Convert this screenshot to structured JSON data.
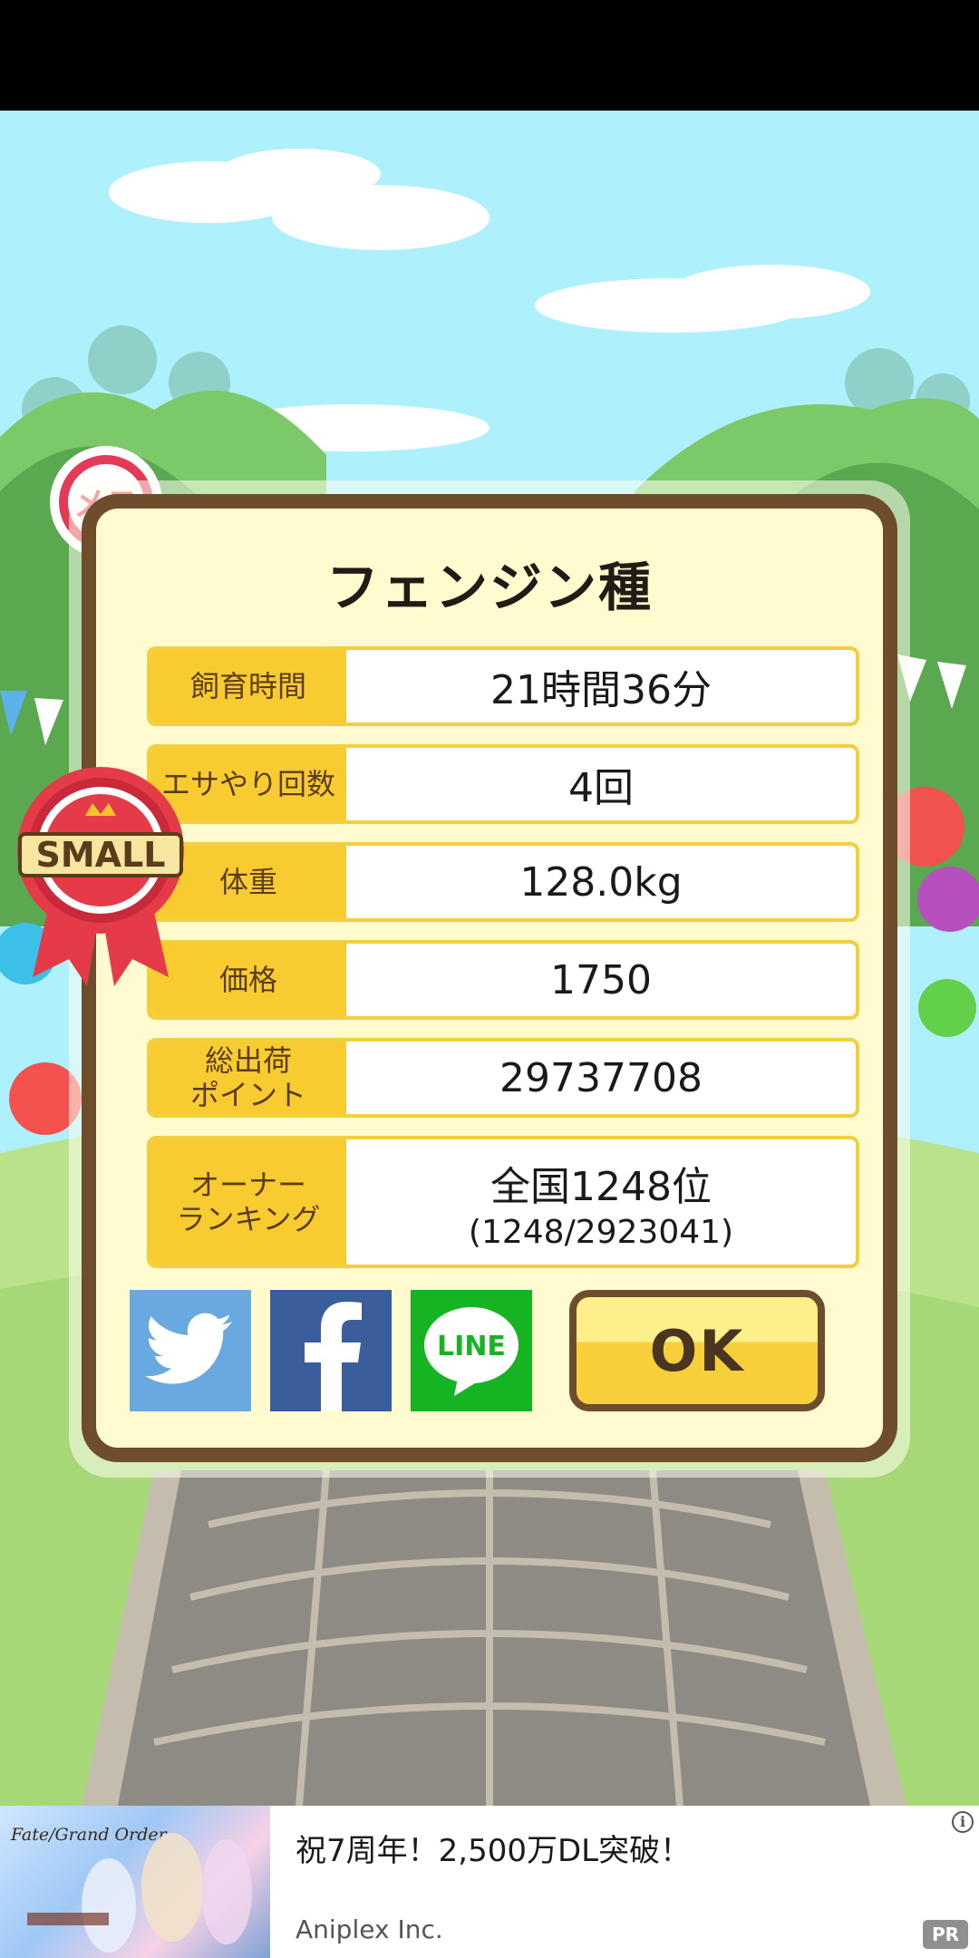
{
  "colors": {
    "sky": "#aef0fc",
    "dialog_bg": "#fffbcf",
    "dialog_border": "#6e4d2b",
    "label_bg": "#f8cb31",
    "twitter": "#6aa9df",
    "facebook": "#3a5d9b",
    "line": "#16b323"
  },
  "badges": {
    "gender": "メス",
    "size": "SMALL"
  },
  "dialog": {
    "title": "フェンジン種",
    "rows": [
      {
        "label": "飼育時間",
        "value": "21時間36分"
      },
      {
        "label": "エサやり回数",
        "value": "4回"
      },
      {
        "label": "体重",
        "value": "128.0kg"
      },
      {
        "label": "価格",
        "value": "1750"
      },
      {
        "label": "総出荷\nポイント",
        "value": "29737708"
      },
      {
        "label": "オーナー\nランキング",
        "value": "全国1248位",
        "sub": "(1248/2923041)"
      }
    ],
    "share_buttons": [
      {
        "name": "twitter",
        "icon": "twitter-bird-icon"
      },
      {
        "name": "facebook",
        "icon": "facebook-f-icon"
      },
      {
        "name": "line",
        "icon": "line-icon",
        "text": "LINE"
      }
    ],
    "ok_label": "OK"
  },
  "ad": {
    "logo": "Fate/Grand Order",
    "title": "祝7周年！2,500万DL突破！",
    "advertiser": "Aniplex Inc.",
    "pr_label": "PR",
    "info_icon": "i"
  }
}
